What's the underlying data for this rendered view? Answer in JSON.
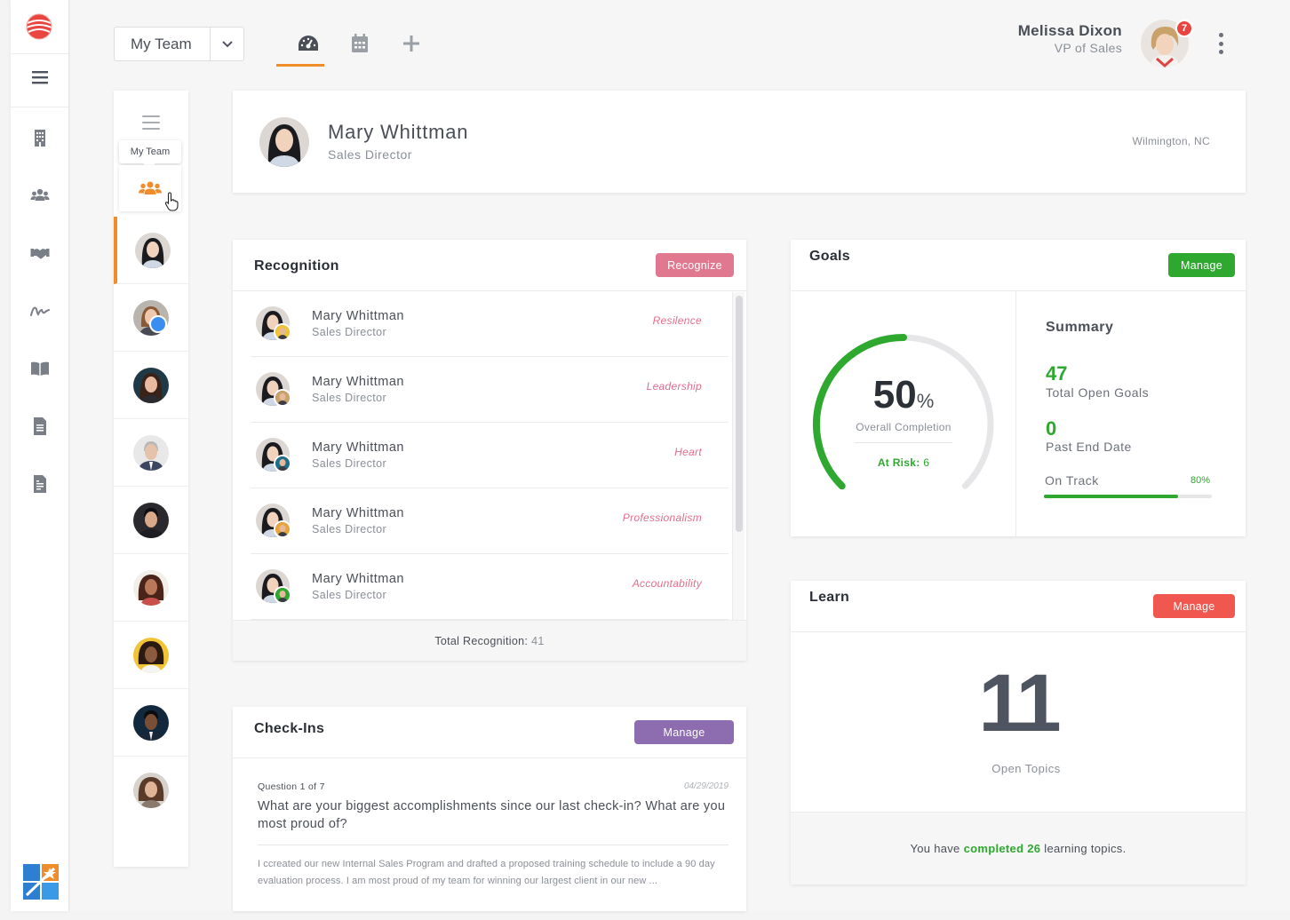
{
  "header": {
    "team_select": "My Team",
    "user_name": "Melissa Dixon",
    "user_role": "VP of Sales",
    "notifications": "7"
  },
  "left_nav": {
    "icons": [
      "menu-icon",
      "building-icon",
      "users-icon",
      "handshake-icon",
      "signature-icon",
      "book-icon",
      "document-icon",
      "report-icon"
    ]
  },
  "team_rail": {
    "tooltip": "My Team"
  },
  "profile": {
    "name": "Mary Whittman",
    "title": "Sales Director",
    "location": "Wilmington, NC"
  },
  "recognition": {
    "title": "Recognition",
    "button": "Recognize",
    "items": [
      {
        "name": "Mary Whittman",
        "title": "Sales Director",
        "tag": "Resilence"
      },
      {
        "name": "Mary Whittman",
        "title": "Sales Director",
        "tag": "Leadership"
      },
      {
        "name": "Mary Whittman",
        "title": "Sales Director",
        "tag": "Heart"
      },
      {
        "name": "Mary Whittman",
        "title": "Sales Director",
        "tag": "Professionalism"
      },
      {
        "name": "Mary Whittman",
        "title": "Sales Director",
        "tag": "Accountability"
      }
    ],
    "total_label": "Total Recognition:",
    "total_value": "41"
  },
  "goals": {
    "title": "Goals",
    "button": "Manage",
    "completion_value": "50",
    "completion_unit": "%",
    "completion_fraction": 0.5,
    "completion_label": "Overall Completion",
    "at_risk_label": "At Risk:",
    "at_risk_value": "6",
    "summary_title": "Summary",
    "open_goals": "47",
    "open_goals_label": "Total Open Goals",
    "past_end": "0",
    "past_end_label": "Past End Date",
    "on_track_label": "On Track",
    "on_track_pct": "80%",
    "on_track_fraction": 0.8
  },
  "learn": {
    "title": "Learn",
    "button": "Manage",
    "open_topics": "11",
    "open_topics_label": "Open Topics",
    "footer_pre": "You have",
    "footer_highlight": "completed 26",
    "footer_post": "learning topics."
  },
  "checkins": {
    "title": "Check-Ins",
    "button": "Manage",
    "question_counter": "Question 1 of 7",
    "date": "04/29/2019",
    "question": "What are your biggest accomplishments since our last check-in?  What are you most proud of?",
    "answer": "I ccreated our new Internal Sales Program and drafted a proposed training schedule to include a 90 day evaluation process.  I am most proud of my team for winning our largest client in our new ..."
  },
  "colors": {
    "accent": "#f08c2a",
    "green": "#2ea82e",
    "pink": "#e0798f",
    "red": "#f0584f",
    "purple": "#8d6cb0"
  }
}
